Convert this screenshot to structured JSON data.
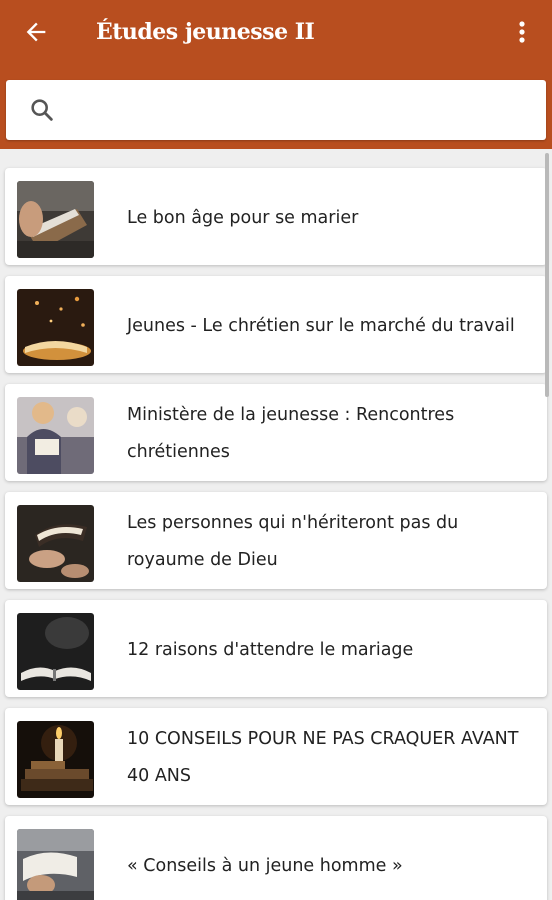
{
  "app": {
    "title": "Études jeunesse II",
    "brand_color": "#b84e1f"
  },
  "header": {
    "back_icon": "arrow-left-icon",
    "menu_icon": "more-vert-icon"
  },
  "search": {
    "icon": "search-icon",
    "placeholder": "",
    "value": ""
  },
  "items": [
    {
      "label": "Le bon âge pour se marier",
      "thumb": "hand-holding-book"
    },
    {
      "label": "Jeunes - Le chrétien sur le marché du travail",
      "thumb": "open-book-sparkles"
    },
    {
      "label": "Ministère de la jeunesse : Rencontres chrétiennes",
      "thumb": "woman-reading"
    },
    {
      "label": "Les personnes qui n'hériteront pas du royaume de Dieu",
      "thumb": "hands-with-book"
    },
    {
      "label": "12 raisons d'attendre le mariage",
      "thumb": "open-book-dark"
    },
    {
      "label": "10 CONSEILS POUR NE PAS CRAQUER AVANT 40 ANS",
      "thumb": "candle-and-books"
    },
    {
      "label": "« Conseils à un jeune homme »",
      "thumb": "reading-bible"
    }
  ]
}
